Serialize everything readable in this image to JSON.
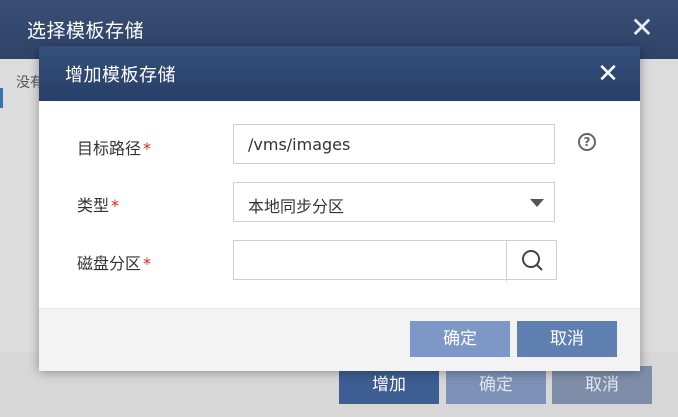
{
  "outer": {
    "title": "选择模板存储",
    "left_text": "没有",
    "buttons": {
      "add": "增加",
      "ok": "确定",
      "cancel": "取消"
    }
  },
  "modal": {
    "title": "增加模板存储",
    "fields": {
      "target_path": {
        "label": "目标路径",
        "value": "/vms/images"
      },
      "type": {
        "label": "类型",
        "value": "本地同步分区"
      },
      "disk_partition": {
        "label": "磁盘分区",
        "value": ""
      }
    },
    "buttons": {
      "ok": "确定",
      "cancel": "取消"
    }
  },
  "icons": {
    "close": "close-icon",
    "help": "help-icon",
    "search": "search-icon",
    "dropdown": "chevron-down-icon"
  },
  "colors": {
    "header": "#2f4268",
    "required": "#e02020",
    "button_primary": "#5f7fb0"
  }
}
